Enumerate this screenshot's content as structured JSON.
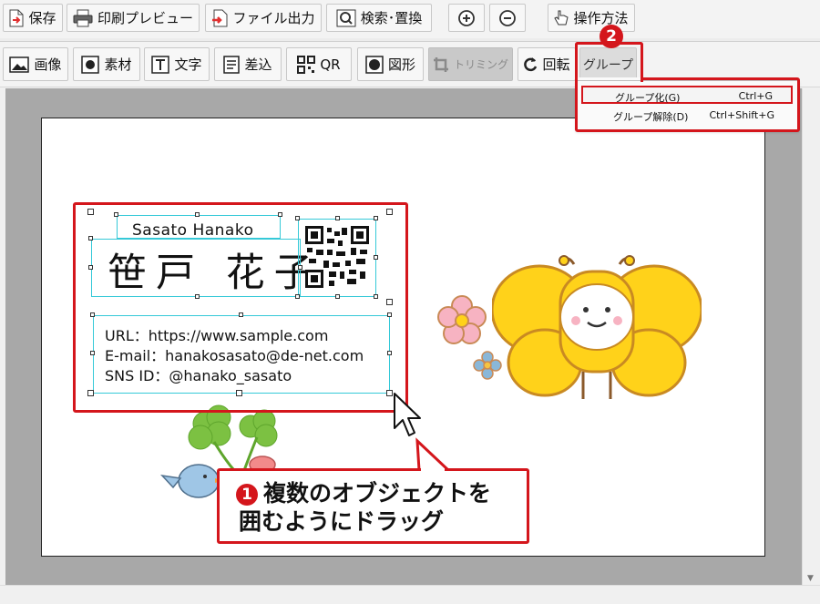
{
  "toolbar_top": {
    "save": "保存",
    "print_preview": "印刷プレビュー",
    "file_output": "ファイル出力",
    "search_replace": "検索･置換",
    "how_to": "操作方法"
  },
  "toolbar_objects": {
    "image": "画像",
    "material": "素材",
    "text": "文字",
    "merge": "差込",
    "qr": "QR",
    "shape": "図形",
    "trimming": "トリミング",
    "rotate": "回転",
    "group": "グループ"
  },
  "group_menu": {
    "items": [
      {
        "label": "グループ化(G)",
        "shortcut": "Ctrl+G"
      },
      {
        "label": "グループ解除(D)",
        "shortcut": "Ctrl+Shift+G"
      }
    ]
  },
  "card": {
    "name_en": "Sasato Hanako",
    "name_jp": "笹戸 花子",
    "url": "URL：https://www.sample.com",
    "email": "E-mail：hanakosasato@de-net.com",
    "sns": "SNS ID：@hanako_sasato"
  },
  "callouts": {
    "step1_badge": "1",
    "step1_line1": "複数のオブジェクトを",
    "step1_line2": "囲むようにドラッグ",
    "step2_badge": "2"
  },
  "colors": {
    "highlight_red": "#d4161c",
    "selection_cyan": "#35c9d8",
    "canvas_gray": "#a8a8a8"
  }
}
